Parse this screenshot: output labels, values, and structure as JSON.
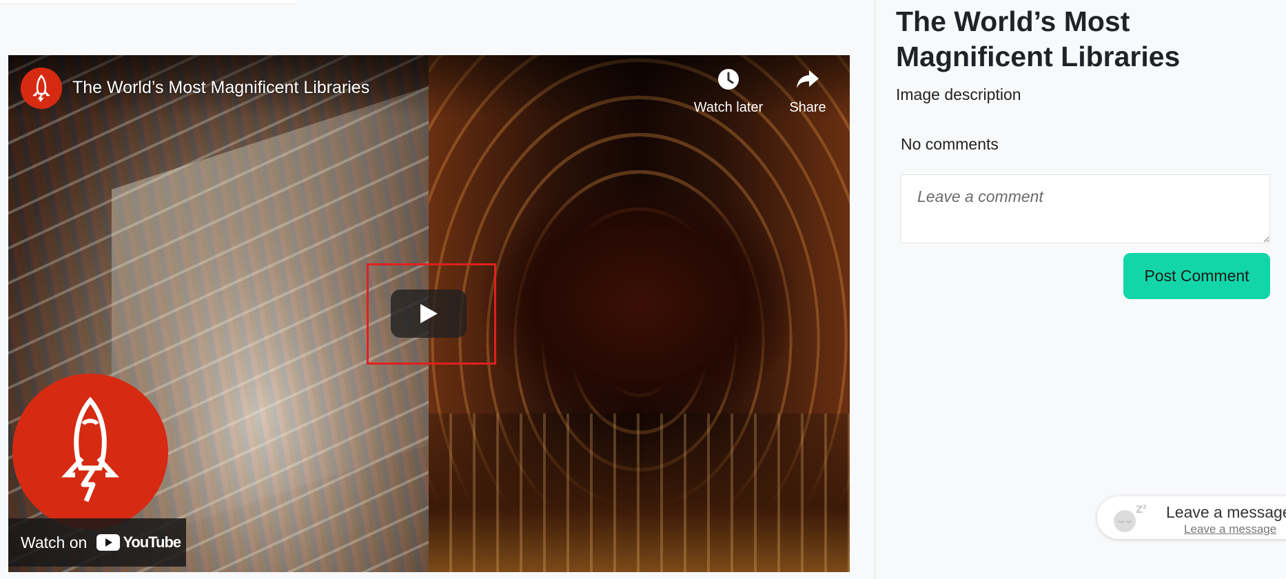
{
  "video": {
    "title": "The World’s Most Magnificent Libraries",
    "watch_later_label": "Watch later",
    "share_label": "Share",
    "watch_on_label": "Watch on",
    "youtube_label": "YouTube"
  },
  "panel": {
    "title": "The World’s Most Magnificent Libraries",
    "image_description": "Image description",
    "comments_status": "No comments",
    "comment_placeholder": "Leave a comment",
    "post_button_label": "Post Comment"
  },
  "chat_widget": {
    "title": "Leave a message",
    "link": "Leave a message"
  },
  "colors": {
    "accent": "#12d6a8",
    "brand_red": "#d62a12",
    "highlight": "#e02020"
  }
}
